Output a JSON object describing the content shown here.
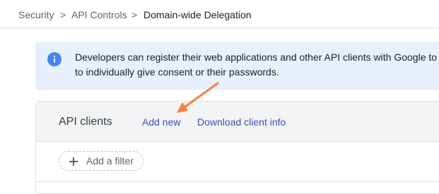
{
  "breadcrumb": {
    "items": [
      "Security",
      "API Controls",
      "Domain-wide Delegation"
    ],
    "separator": ">"
  },
  "info_banner": {
    "icon": "info-icon",
    "line1": "Developers can register their web applications and other API clients with Google to",
    "line2": "to individually give consent or their passwords."
  },
  "api_clients": {
    "title": "API clients",
    "add_new_label": "Add new",
    "download_label": "Download client info",
    "filter_label": "Add a filter",
    "filter_icon": "plus-icon"
  },
  "annotation": {
    "arrow_color": "#f4813f"
  },
  "colors": {
    "link": "#3f51b5",
    "info_blue": "#4285f4",
    "banner_bg": "#e8f0fe",
    "header_bg": "#f1f3f4"
  }
}
